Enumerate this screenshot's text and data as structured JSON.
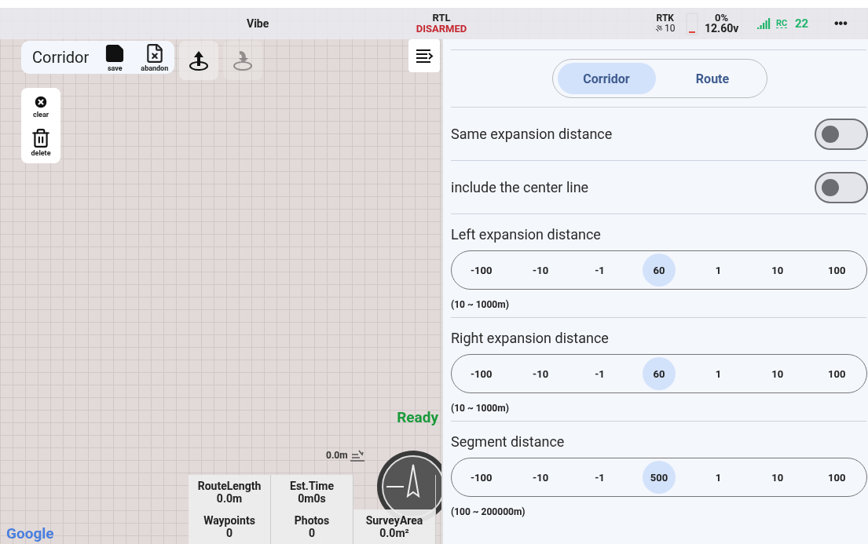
{
  "status_bar": {
    "app_name": "Vibe",
    "flight_mode": "RTL",
    "arm_state": "DISARMED",
    "rtk_label": "RTK",
    "satellites": "10",
    "battery_percent": "0%",
    "voltage": "12.60v",
    "rc_label": "RC",
    "rc_signal": "22",
    "menu": "•••"
  },
  "mission_toolbar": {
    "title": "Corridor",
    "buttons": [
      {
        "kind": "save",
        "label": "save"
      },
      {
        "kind": "abandon",
        "label": "abandon"
      }
    ],
    "icon_buttons": [
      {
        "kind": "upload",
        "disabled": false
      },
      {
        "kind": "land",
        "disabled": true
      }
    ]
  },
  "side_tools": [
    {
      "kind": "clear",
      "label": "clear"
    },
    {
      "kind": "delete",
      "label": "delete"
    }
  ],
  "map": {
    "status": "Ready",
    "altitude": "0.0m",
    "attribution": "Google"
  },
  "stats": {
    "rows": [
      [
        {
          "label": "RouteLength",
          "value": "0.0m"
        },
        {
          "label": "Est.Time",
          "value": "0m0s"
        }
      ],
      [
        {
          "label": "Waypoints",
          "value": "0"
        },
        {
          "label": "Photos",
          "value": "0"
        },
        {
          "label": "SurveyArea",
          "value": "0.0m²"
        }
      ]
    ]
  },
  "panel": {
    "tabs": [
      {
        "label": "Corridor",
        "selected": true
      },
      {
        "label": "Route",
        "selected": false
      }
    ],
    "toggles": [
      {
        "label": "Same expansion distance",
        "on": false
      },
      {
        "label": "include the center line",
        "on": false
      }
    ],
    "steppers": [
      {
        "label": "Left expansion distance",
        "decrements": [
          "-100",
          "-10",
          "-1"
        ],
        "value": "60",
        "increments": [
          "1",
          "10",
          "100"
        ],
        "range": "(10 ~ 1000m)"
      },
      {
        "label": "Right expansion distance",
        "decrements": [
          "-100",
          "-10",
          "-1"
        ],
        "value": "60",
        "increments": [
          "1",
          "10",
          "100"
        ],
        "range": "(10 ~ 1000m)"
      },
      {
        "label": "Segment distance",
        "decrements": [
          "-100",
          "-10",
          "-1"
        ],
        "value": "500",
        "increments": [
          "1",
          "10",
          "100"
        ],
        "range": "(100 ~ 200000m)"
      }
    ]
  }
}
